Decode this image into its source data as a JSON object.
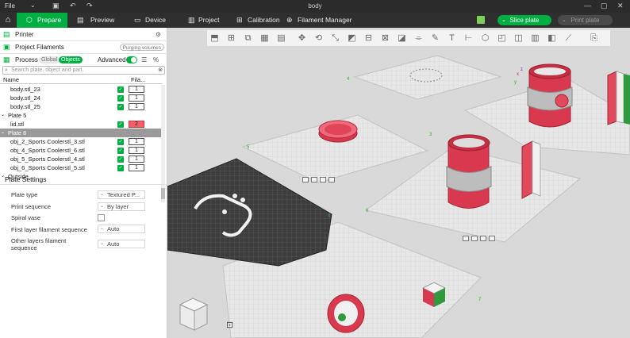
{
  "titlebar": {
    "file_label": "File",
    "document_title": "body"
  },
  "menubar": {
    "tabs": [
      {
        "label": "Prepare",
        "active": true
      },
      {
        "label": "Preview",
        "active": false
      },
      {
        "label": "Device",
        "active": false
      },
      {
        "label": "Project",
        "active": false
      },
      {
        "label": "Calibration",
        "active": false
      },
      {
        "label": "Filament Manager",
        "active": false
      }
    ],
    "slice_label": "Slice plate",
    "print_label": "Print plate"
  },
  "sidebar": {
    "printer_label": "Printer",
    "project_filaments_label": "Project Filaments",
    "purging_volumes_label": "Purging volumes",
    "process_label": "Process",
    "global_label": "Global",
    "objects_label": "Objects",
    "advanced_label": "Advanced",
    "search_placeholder": "Search plate, object and part.",
    "col_name": "Name",
    "col_fila": "Fila..."
  },
  "object_list": [
    {
      "name": "body.stl_23",
      "fila": "1",
      "type": "obj"
    },
    {
      "name": "body.stl_24",
      "fila": "1",
      "type": "obj"
    },
    {
      "name": "body.stl_25",
      "fila": "1",
      "type": "obj"
    },
    {
      "name": "Plate 5",
      "fila": "",
      "type": "plate"
    },
    {
      "name": "lid.stl",
      "fila": "2",
      "type": "obj-red"
    },
    {
      "name": "Plate 6",
      "fila": "",
      "type": "plate-sel"
    },
    {
      "name": "obj_2_Sports Coolerstl_3.stl",
      "fila": "1",
      "type": "obj"
    },
    {
      "name": "obj_4_Sports Coolerstl_6.stl",
      "fila": "1",
      "type": "obj"
    },
    {
      "name": "obj_5_Sports Coolerstl_4.stl",
      "fila": "1",
      "type": "obj"
    },
    {
      "name": "obj_6_Sports Coolerstl_5.stl",
      "fila": "1",
      "type": "obj"
    },
    {
      "name": "Outside",
      "fila": "",
      "type": "plate"
    }
  ],
  "plate_settings": {
    "title": "Plate Settings",
    "plate_type_label": "Plate type",
    "plate_type_value": "Textured P...",
    "print_sequence_label": "Print sequence",
    "print_sequence_value": "By layer",
    "spiral_vase_label": "Spiral vase",
    "first_layer_label": "First layer filament sequence",
    "first_layer_value": "Auto",
    "other_layers_label_1": "Other layers filament",
    "other_layers_label_2": "sequence",
    "other_layers_value": "Auto"
  },
  "viewport": {
    "plate_numbers": [
      "4",
      "5",
      "6",
      "3",
      "7",
      "9"
    ],
    "axis": {
      "x": "x",
      "y": "y",
      "z": "z"
    },
    "colors": {
      "filament_red": "#e8485a",
      "filament_white": "#eeeeee",
      "filament_green": "#2f9a3b",
      "accent": "#00ae42"
    }
  }
}
